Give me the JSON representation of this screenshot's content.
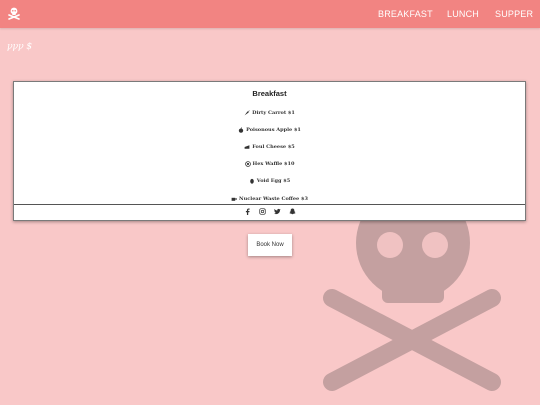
{
  "nav": {
    "logo_icon": "skull-crossbones-icon",
    "items": [
      {
        "label": "BREAKFAST"
      },
      {
        "label": "LUNCH"
      },
      {
        "label": "SUPPER"
      }
    ]
  },
  "page": {
    "subtitle": "ꝩꝩꝩ $"
  },
  "menu": {
    "title": "Breakfast",
    "items": [
      {
        "label": "Dirty Carrot $1",
        "icon": "carrot-icon"
      },
      {
        "label": "Poisonous Apple $1",
        "icon": "apple-icon"
      },
      {
        "label": "Foul Cheese $5",
        "icon": "cheese-icon"
      },
      {
        "label": "Hex Waffle $10",
        "icon": "waffle-icon"
      },
      {
        "label": "Void Egg $5",
        "icon": "egg-icon"
      },
      {
        "label": "Nuclear Waste Coffee $3",
        "icon": "coffee-icon"
      }
    ],
    "socials": [
      "facebook-icon",
      "instagram-icon",
      "twitter-icon",
      "snapchat-icon"
    ]
  },
  "cta": {
    "label": "Book Now"
  },
  "colors": {
    "navbar": "#f28482",
    "background": "#f9c8c8",
    "watermark": "#c4a0a0"
  }
}
